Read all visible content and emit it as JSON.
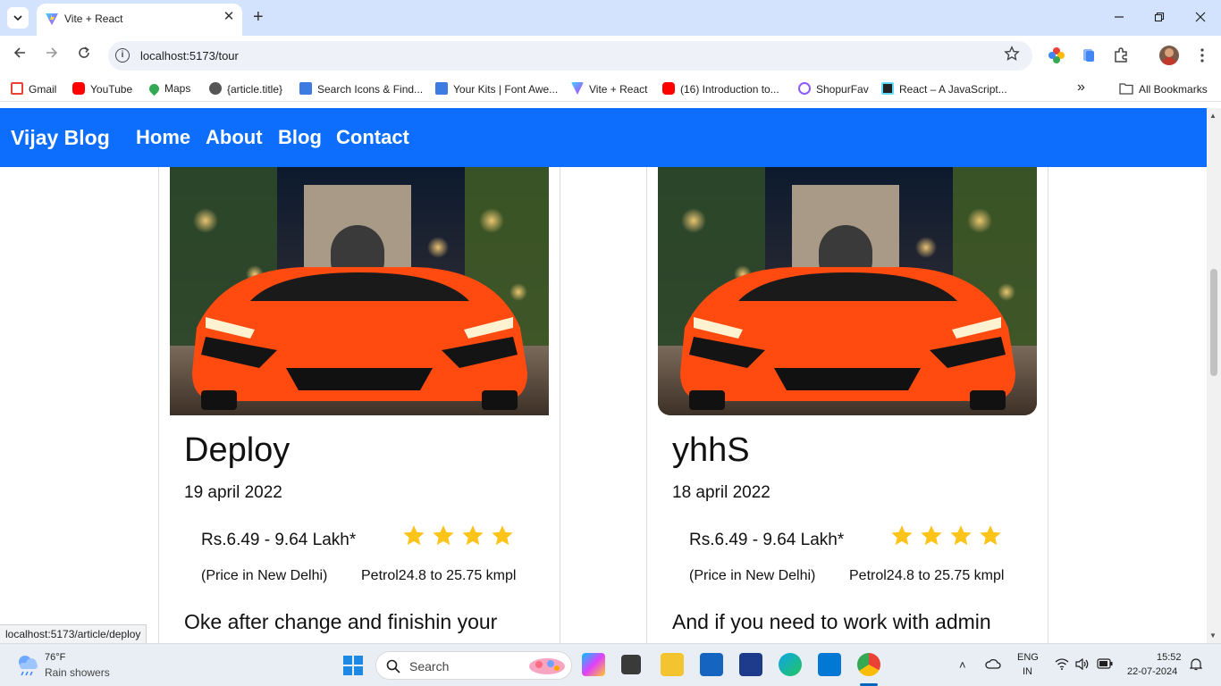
{
  "browser": {
    "tab_title": "Vite + React",
    "tab_close": "✕",
    "new_tab": "+",
    "url": "localhost:5173/tour",
    "status_url": "localhost:5173/article/deploy",
    "bookmarks": [
      {
        "label": "Gmail",
        "icon": "gmail-icon",
        "color": "#ea4335"
      },
      {
        "label": "YouTube",
        "icon": "youtube-icon",
        "color": "#ff0000"
      },
      {
        "label": "Maps",
        "icon": "maps-icon",
        "color": "#34a853"
      },
      {
        "label": "{article.title}",
        "icon": "globe-icon",
        "color": "#555555"
      },
      {
        "label": "Search Icons & Find...",
        "icon": "fontawesome-icon",
        "color": "#3d7be0"
      },
      {
        "label": "Your Kits | Font Awe...",
        "icon": "fontawesome-icon",
        "color": "#3d7be0"
      },
      {
        "label": "Vite + React",
        "icon": "vite-icon",
        "color": "#a855f7"
      },
      {
        "label": "(16) Introduction to...",
        "icon": "youtube-icon",
        "color": "#ff0000"
      },
      {
        "label": "ShopurFav",
        "icon": "shopurfav-icon",
        "color": "#8b5cf6"
      },
      {
        "label": "React – A JavaScript...",
        "icon": "react-icon",
        "color": "#222222"
      }
    ],
    "more_bookmarks": "»",
    "all_bookmarks": "All Bookmarks"
  },
  "site": {
    "brand": "Vijay Blog",
    "nav": [
      "Home",
      "About",
      "Blog",
      "Contact"
    ]
  },
  "cards": [
    {
      "title": "Deploy",
      "date": "19 april 2022",
      "price": "Rs.6.49 - 9.64 Lakh*",
      "rating": 4,
      "location": "(Price in New Delhi)",
      "mileage": "Petrol24.8 to 25.75 kmpl",
      "excerpt": "Oke after change and finishin your"
    },
    {
      "title": "yhhS",
      "date": "18 april 2022",
      "price": "Rs.6.49 - 9.64 Lakh*",
      "rating": 4,
      "location": "(Price in New Delhi)",
      "mileage": "Petrol24.8 to 25.75 kmpl",
      "excerpt": "And if you need to work with admin"
    }
  ],
  "taskbar": {
    "weather_temp": "76°F",
    "weather_desc": "Rain showers",
    "search_label": "Search",
    "lang_line1": "ENG",
    "lang_line2": "IN",
    "time": "15:52",
    "date": "22-07-2024"
  },
  "colors": {
    "navbar": "#0d6efd",
    "star": "#fcc419",
    "tabstrip": "#d3e3fd"
  }
}
